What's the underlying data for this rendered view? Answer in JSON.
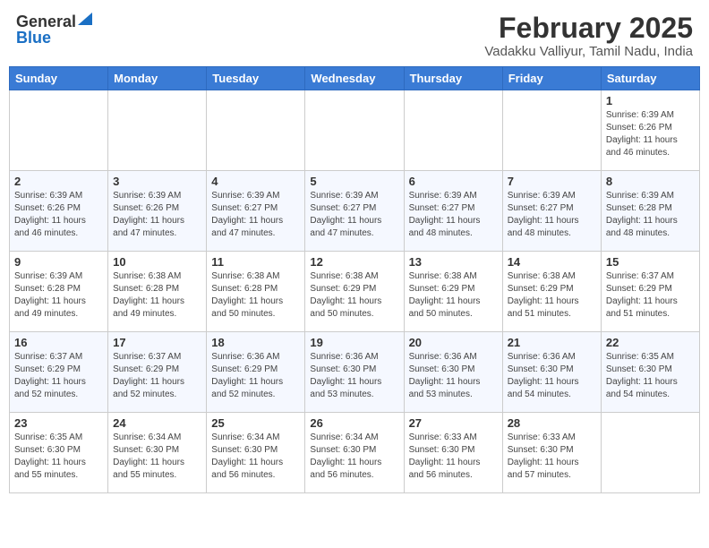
{
  "header": {
    "logo_general": "General",
    "logo_blue": "Blue",
    "month": "February 2025",
    "location": "Vadakku Valliyur, Tamil Nadu, India"
  },
  "days_of_week": [
    "Sunday",
    "Monday",
    "Tuesday",
    "Wednesday",
    "Thursday",
    "Friday",
    "Saturday"
  ],
  "weeks": [
    [
      {
        "day": "",
        "info": ""
      },
      {
        "day": "",
        "info": ""
      },
      {
        "day": "",
        "info": ""
      },
      {
        "day": "",
        "info": ""
      },
      {
        "day": "",
        "info": ""
      },
      {
        "day": "",
        "info": ""
      },
      {
        "day": "1",
        "info": "Sunrise: 6:39 AM\nSunset: 6:26 PM\nDaylight: 11 hours\nand 46 minutes."
      }
    ],
    [
      {
        "day": "2",
        "info": "Sunrise: 6:39 AM\nSunset: 6:26 PM\nDaylight: 11 hours\nand 46 minutes."
      },
      {
        "day": "3",
        "info": "Sunrise: 6:39 AM\nSunset: 6:26 PM\nDaylight: 11 hours\nand 47 minutes."
      },
      {
        "day": "4",
        "info": "Sunrise: 6:39 AM\nSunset: 6:27 PM\nDaylight: 11 hours\nand 47 minutes."
      },
      {
        "day": "5",
        "info": "Sunrise: 6:39 AM\nSunset: 6:27 PM\nDaylight: 11 hours\nand 47 minutes."
      },
      {
        "day": "6",
        "info": "Sunrise: 6:39 AM\nSunset: 6:27 PM\nDaylight: 11 hours\nand 48 minutes."
      },
      {
        "day": "7",
        "info": "Sunrise: 6:39 AM\nSunset: 6:27 PM\nDaylight: 11 hours\nand 48 minutes."
      },
      {
        "day": "8",
        "info": "Sunrise: 6:39 AM\nSunset: 6:28 PM\nDaylight: 11 hours\nand 48 minutes."
      }
    ],
    [
      {
        "day": "9",
        "info": "Sunrise: 6:39 AM\nSunset: 6:28 PM\nDaylight: 11 hours\nand 49 minutes."
      },
      {
        "day": "10",
        "info": "Sunrise: 6:38 AM\nSunset: 6:28 PM\nDaylight: 11 hours\nand 49 minutes."
      },
      {
        "day": "11",
        "info": "Sunrise: 6:38 AM\nSunset: 6:28 PM\nDaylight: 11 hours\nand 50 minutes."
      },
      {
        "day": "12",
        "info": "Sunrise: 6:38 AM\nSunset: 6:29 PM\nDaylight: 11 hours\nand 50 minutes."
      },
      {
        "day": "13",
        "info": "Sunrise: 6:38 AM\nSunset: 6:29 PM\nDaylight: 11 hours\nand 50 minutes."
      },
      {
        "day": "14",
        "info": "Sunrise: 6:38 AM\nSunset: 6:29 PM\nDaylight: 11 hours\nand 51 minutes."
      },
      {
        "day": "15",
        "info": "Sunrise: 6:37 AM\nSunset: 6:29 PM\nDaylight: 11 hours\nand 51 minutes."
      }
    ],
    [
      {
        "day": "16",
        "info": "Sunrise: 6:37 AM\nSunset: 6:29 PM\nDaylight: 11 hours\nand 52 minutes."
      },
      {
        "day": "17",
        "info": "Sunrise: 6:37 AM\nSunset: 6:29 PM\nDaylight: 11 hours\nand 52 minutes."
      },
      {
        "day": "18",
        "info": "Sunrise: 6:36 AM\nSunset: 6:29 PM\nDaylight: 11 hours\nand 52 minutes."
      },
      {
        "day": "19",
        "info": "Sunrise: 6:36 AM\nSunset: 6:30 PM\nDaylight: 11 hours\nand 53 minutes."
      },
      {
        "day": "20",
        "info": "Sunrise: 6:36 AM\nSunset: 6:30 PM\nDaylight: 11 hours\nand 53 minutes."
      },
      {
        "day": "21",
        "info": "Sunrise: 6:36 AM\nSunset: 6:30 PM\nDaylight: 11 hours\nand 54 minutes."
      },
      {
        "day": "22",
        "info": "Sunrise: 6:35 AM\nSunset: 6:30 PM\nDaylight: 11 hours\nand 54 minutes."
      }
    ],
    [
      {
        "day": "23",
        "info": "Sunrise: 6:35 AM\nSunset: 6:30 PM\nDaylight: 11 hours\nand 55 minutes."
      },
      {
        "day": "24",
        "info": "Sunrise: 6:34 AM\nSunset: 6:30 PM\nDaylight: 11 hours\nand 55 minutes."
      },
      {
        "day": "25",
        "info": "Sunrise: 6:34 AM\nSunset: 6:30 PM\nDaylight: 11 hours\nand 56 minutes."
      },
      {
        "day": "26",
        "info": "Sunrise: 6:34 AM\nSunset: 6:30 PM\nDaylight: 11 hours\nand 56 minutes."
      },
      {
        "day": "27",
        "info": "Sunrise: 6:33 AM\nSunset: 6:30 PM\nDaylight: 11 hours\nand 56 minutes."
      },
      {
        "day": "28",
        "info": "Sunrise: 6:33 AM\nSunset: 6:30 PM\nDaylight: 11 hours\nand 57 minutes."
      },
      {
        "day": "",
        "info": ""
      }
    ]
  ]
}
